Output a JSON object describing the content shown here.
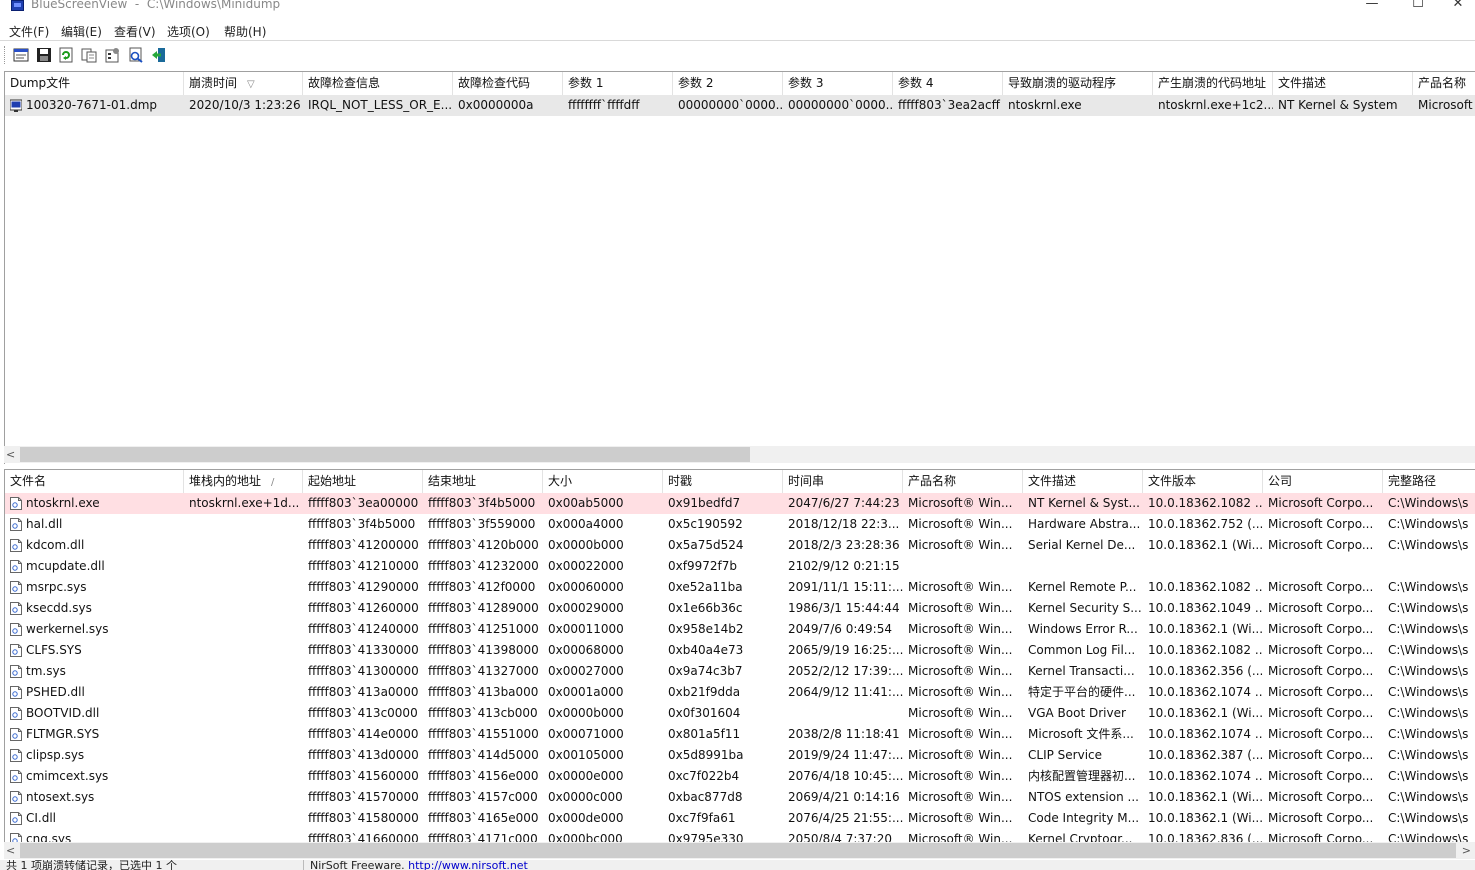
{
  "window": {
    "app_name": "BlueScreenView",
    "separator": "  -  ",
    "path": "C:\\Windows\\Minidump",
    "minimize": "—",
    "maximize": "☐",
    "close": "✕"
  },
  "menu": [
    "文件(F)",
    "编辑(E)",
    "查看(V)",
    "选项(O)",
    "帮助(H)"
  ],
  "toolbar_icons": [
    "html-report-icon",
    "save-icon",
    "refresh-icon",
    "copy-icon",
    "properties-icon",
    "find-icon",
    "exit-icon"
  ],
  "top_table": {
    "columns": [
      "Dump文件",
      "崩溃时间",
      "故障检查信息",
      "故障检查代码",
      "参数 1",
      "参数 2",
      "参数 3",
      "参数 4",
      "导致崩溃的驱动程序",
      "产生崩溃的代码地址",
      "文件描述",
      "产品名称"
    ],
    "sort_indicator": "▽",
    "rows": [
      [
        "100320-7671-01.dmp",
        "2020/10/3 1:23:26",
        "IRQL_NOT_LESS_OR_E...",
        "0x0000000a",
        "ffffffff`ffffdff",
        "00000000`0000...",
        "00000000`0000...",
        "fffff803`3ea2acff",
        "ntoskrnl.exe",
        "ntoskrnl.exe+1c2...",
        "NT Kernel & System",
        "Microsoft"
      ]
    ]
  },
  "bottom_table": {
    "columns": [
      "文件名",
      "堆栈内的地址",
      "起始地址",
      "结束地址",
      "大小",
      "时戳",
      "时间串",
      "产品名称",
      "文件描述",
      "文件版本",
      "公司",
      "完整路径"
    ],
    "sort_indicator": "/",
    "rows": [
      [
        "ntoskrnl.exe",
        "ntoskrnl.exe+1d...",
        "fffff803`3ea00000",
        "fffff803`3f4b5000",
        "0x00ab5000",
        "0x91bedfd7",
        "2047/6/27 7:44:23",
        "Microsoft® Win...",
        "NT Kernel & Syst...",
        "10.0.18362.1082 ...",
        "Microsoft Corpo...",
        "C:\\Windows\\s"
      ],
      [
        "hal.dll",
        "",
        "fffff803`3f4b5000",
        "fffff803`3f559000",
        "0x000a4000",
        "0x5c190592",
        "2018/12/18 22:3...",
        "Microsoft® Win...",
        "Hardware Abstra...",
        "10.0.18362.752 (...",
        "Microsoft Corpo...",
        "C:\\Windows\\s"
      ],
      [
        "kdcom.dll",
        "",
        "fffff803`41200000",
        "fffff803`4120b000",
        "0x0000b000",
        "0x5a75d524",
        "2018/2/3 23:28:36",
        "Microsoft® Win...",
        "Serial Kernel De...",
        "10.0.18362.1 (Wi...",
        "Microsoft Corpo...",
        "C:\\Windows\\s"
      ],
      [
        "mcupdate.dll",
        "",
        "fffff803`41210000",
        "fffff803`41232000",
        "0x00022000",
        "0xf9972f7b",
        "2102/9/12 0:21:15",
        "",
        "",
        "",
        "",
        ""
      ],
      [
        "msrpc.sys",
        "",
        "fffff803`41290000",
        "fffff803`412f0000",
        "0x00060000",
        "0xe52a11ba",
        "2091/11/1 15:11:...",
        "Microsoft® Win...",
        "Kernel Remote P...",
        "10.0.18362.1082 ...",
        "Microsoft Corpo...",
        "C:\\Windows\\s"
      ],
      [
        "ksecdd.sys",
        "",
        "fffff803`41260000",
        "fffff803`41289000",
        "0x00029000",
        "0x1e66b36c",
        "1986/3/1 15:44:44",
        "Microsoft® Win...",
        "Kernel Security S...",
        "10.0.18362.1049 ...",
        "Microsoft Corpo...",
        "C:\\Windows\\s"
      ],
      [
        "werkernel.sys",
        "",
        "fffff803`41240000",
        "fffff803`41251000",
        "0x00011000",
        "0x958e14b2",
        "2049/7/6 0:49:54",
        "Microsoft® Win...",
        "Windows Error R...",
        "10.0.18362.1 (Wi...",
        "Microsoft Corpo...",
        "C:\\Windows\\s"
      ],
      [
        "CLFS.SYS",
        "",
        "fffff803`41330000",
        "fffff803`41398000",
        "0x00068000",
        "0xb40a4e73",
        "2065/9/19 16:25:...",
        "Microsoft® Win...",
        "Common Log Fil...",
        "10.0.18362.1082 ...",
        "Microsoft Corpo...",
        "C:\\Windows\\s"
      ],
      [
        "tm.sys",
        "",
        "fffff803`41300000",
        "fffff803`41327000",
        "0x00027000",
        "0x9a74c3b7",
        "2052/2/12 17:39:...",
        "Microsoft® Win...",
        "Kernel Transacti...",
        "10.0.18362.356 (...",
        "Microsoft Corpo...",
        "C:\\Windows\\s"
      ],
      [
        "PSHED.dll",
        "",
        "fffff803`413a0000",
        "fffff803`413ba000",
        "0x0001a000",
        "0xb21f9dda",
        "2064/9/12 11:41:...",
        "Microsoft® Win...",
        "特定于平台的硬件...",
        "10.0.18362.1074 ...",
        "Microsoft Corpo...",
        "C:\\Windows\\s"
      ],
      [
        "BOOTVID.dll",
        "",
        "fffff803`413c0000",
        "fffff803`413cb000",
        "0x0000b000",
        "0x0f301604",
        "",
        "Microsoft® Win...",
        "VGA Boot Driver",
        "10.0.18362.1 (Wi...",
        "Microsoft Corpo...",
        "C:\\Windows\\s"
      ],
      [
        "FLTMGR.SYS",
        "",
        "fffff803`414e0000",
        "fffff803`41551000",
        "0x00071000",
        "0x801a5f11",
        "2038/2/8 11:18:41",
        "Microsoft® Win...",
        "Microsoft 文件系...",
        "10.0.18362.1074 ...",
        "Microsoft Corpo...",
        "C:\\Windows\\s"
      ],
      [
        "clipsp.sys",
        "",
        "fffff803`413d0000",
        "fffff803`414d5000",
        "0x00105000",
        "0x5d8991ba",
        "2019/9/24 11:47:...",
        "Microsoft® Win...",
        "CLIP Service",
        "10.0.18362.387 (...",
        "Microsoft Corpo...",
        "C:\\Windows\\s"
      ],
      [
        "cmimcext.sys",
        "",
        "fffff803`41560000",
        "fffff803`4156e000",
        "0x0000e000",
        "0xc7f022b4",
        "2076/4/18 10:45:...",
        "Microsoft® Win...",
        "内核配置管理器初...",
        "10.0.18362.1074 ...",
        "Microsoft Corpo...",
        "C:\\Windows\\s"
      ],
      [
        "ntosext.sys",
        "",
        "fffff803`41570000",
        "fffff803`4157c000",
        "0x0000c000",
        "0xbac877d8",
        "2069/4/21 0:14:16",
        "Microsoft® Win...",
        "NTOS extension ...",
        "10.0.18362.1 (Wi...",
        "Microsoft Corpo...",
        "C:\\Windows\\s"
      ],
      [
        "CI.dll",
        "",
        "fffff803`41580000",
        "fffff803`4165e000",
        "0x000de000",
        "0xc7f9fa61",
        "2076/4/25 21:55:...",
        "Microsoft® Win...",
        "Code Integrity M...",
        "10.0.18362.1 (Wi...",
        "Microsoft Corpo...",
        "C:\\Windows\\s"
      ],
      [
        "cng.sys",
        "",
        "fffff803`41660000",
        "fffff803`4171c000",
        "0x000bc000",
        "0x9795e330",
        "2050/8/4 7:37:20",
        "Microsoft® Win...",
        "Kernel Cryptogr...",
        "10.0.18362.836 (...",
        "Microsoft Corpo...",
        "C:\\Windows\\s"
      ]
    ]
  },
  "status": {
    "left": "共 1 项崩溃转储记录，已选中 1 个",
    "right_prefix": "NirSoft Freeware.  ",
    "right_link": "http://www.nirsoft.net"
  },
  "scroll_arrows": {
    "left": "<",
    "right": ">"
  }
}
